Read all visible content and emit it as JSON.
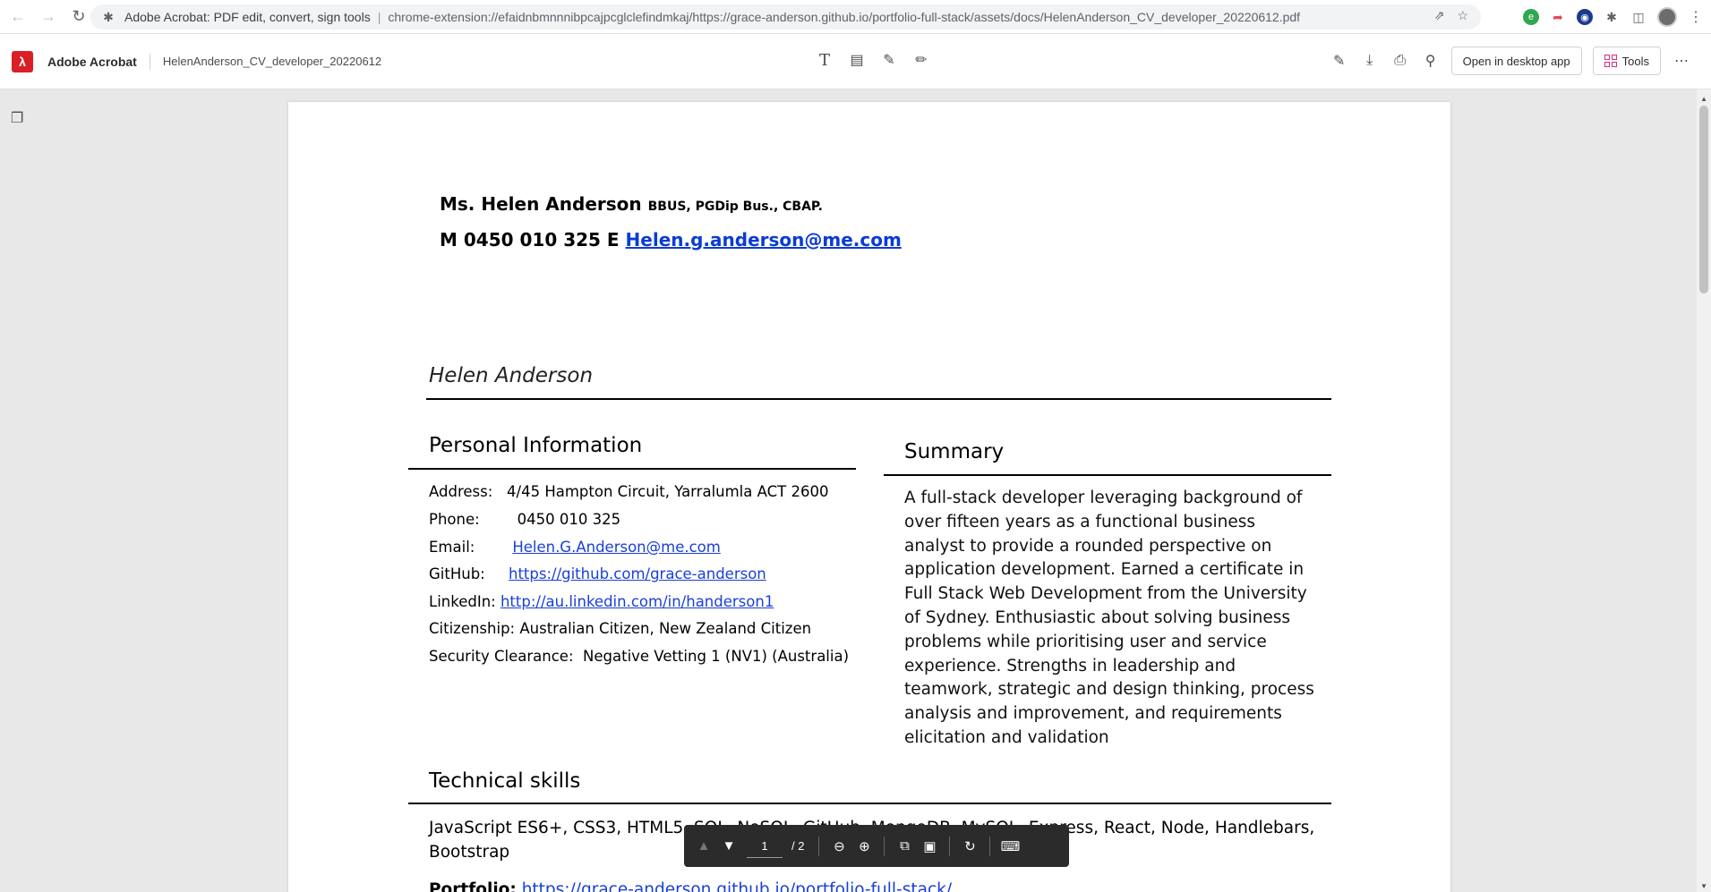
{
  "browser": {
    "site_name": "Adobe Acrobat: PDF edit, convert, sign tools",
    "url": "chrome-extension://efaidnbmnnnibpcajpcglclefindmkaj/https://grace-anderson.github.io/portfolio-full-stack/assets/docs/HelenAnderson_CV_developer_20220612.pdf"
  },
  "acrobat": {
    "app_title": "Adobe Acrobat",
    "file_name": "HelenAnderson_CV_developer_20220612",
    "open_desktop_label": "Open in desktop app",
    "tools_label": "Tools"
  },
  "cv": {
    "name": "Ms. Helen Anderson",
    "quals": "BBUS, PGDip Bus., CBAP.",
    "contact_prefix": "M 0450 010 325 E",
    "contact_email": "Helen.g.anderson@me.com",
    "full_name": "Helen Anderson",
    "personal_title": "Personal Information",
    "summary_title": "Summary",
    "skills_title": "Technical skills",
    "info": [
      {
        "label": "Address:",
        "value": "4/45 Hampton Circuit, Yarralumla ACT 2600",
        "link": false
      },
      {
        "label": "Phone:",
        "value": "0450 010 325",
        "link": false
      },
      {
        "label": "Email:",
        "value": "Helen.G.Anderson@me.com",
        "link": true
      },
      {
        "label": "GitHub:",
        "value": "https://github.com/grace-anderson",
        "link": true
      },
      {
        "label": "LinkedIn:",
        "value": "http://au.linkedin.com/in/handerson1",
        "link": true
      },
      {
        "label": "Citizenship:",
        "value": "Australian Citizen, New Zealand Citizen",
        "link": false
      },
      {
        "label": "Security Clearance:",
        "value": "Negative Vetting 1 (NV1) (Australia)",
        "link": false
      }
    ],
    "summary": "A full-stack developer leveraging background of over fifteen years as a functional business analyst to provide a rounded perspective on application development. Earned a certificate in Full Stack Web Development from the University of Sydney. Enthusiastic about solving business problems while prioritising user and service experience. Strengths in leadership and teamwork, strategic and design thinking, process analysis and improvement, and requirements elicitation and validation",
    "skills_line1": "JavaScript ES6+, CSS3, HTML5, SQL, NoSQL, GitHub, MongoDB, MySQL, Express, React, Node, Handlebars,",
    "skills_line2": "Bootstrap",
    "portfolio_label": "Portfolio:",
    "portfolio_url": "https://grace-anderson.github.io/portfolio-full-stack/"
  },
  "pager": {
    "current_page": "1",
    "total": "/ 2"
  }
}
